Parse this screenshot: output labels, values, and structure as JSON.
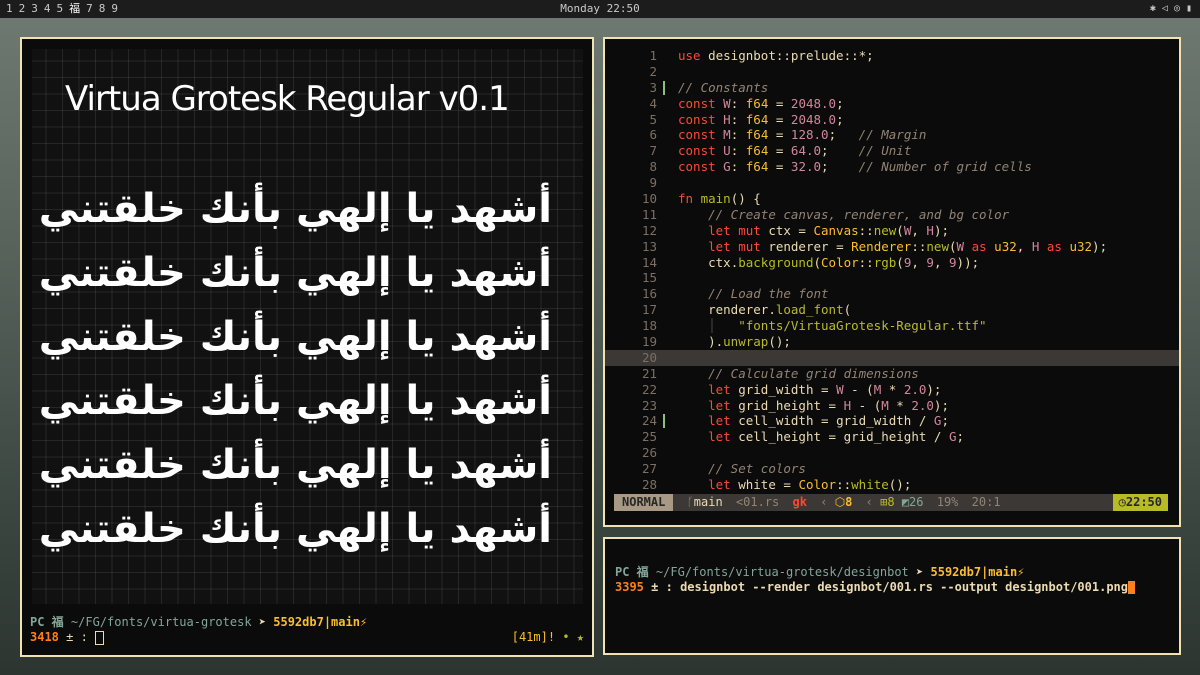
{
  "topbar": {
    "workspaces": [
      "1",
      "2",
      "3",
      "4",
      "5",
      "福",
      "7",
      "8",
      "9"
    ],
    "clock": "Monday 22:50",
    "tray_icons": [
      "bluetooth-icon",
      "speaker-icon",
      "wifi-icon",
      "battery-icon"
    ]
  },
  "preview": {
    "title": "Virtua Grotesk Regular v0.1",
    "arabic_lines": [
      "أشهد يا إلهي بأنك خلقتني",
      "أشهد يا إلهي بأنك خلقتني",
      "أشهد يا إلهي بأنك خلقتني",
      "أشهد يا إلهي بأنك خلقتني",
      "أشهد يا إلهي بأنك خلقتني",
      "أشهد يا إلهي بأنك خلقتني"
    ]
  },
  "left_shell": {
    "host": "PC 福",
    "path": "~/FG/fonts/virtua-grotesk",
    "arrow": "➤",
    "git": "5592db7|main⚡",
    "line_no": "3418",
    "prompt_sym": "± :",
    "timer": "[41m]!",
    "dots": "• ★"
  },
  "editor": {
    "lines": [
      {
        "n": "1",
        "code": "use designbot::prelude::*;"
      },
      {
        "n": "2",
        "code": ""
      },
      {
        "n": "3",
        "code": "// Constants",
        "mark": true
      },
      {
        "n": "4",
        "code": "const W: f64 = 2048.0;"
      },
      {
        "n": "5",
        "code": "const H: f64 = 2048.0;"
      },
      {
        "n": "6",
        "code": "const M: f64 = 128.0;   // Margin"
      },
      {
        "n": "7",
        "code": "const U: f64 = 64.0;    // Unit"
      },
      {
        "n": "8",
        "code": "const G: f64 = 32.0;    // Number of grid cells"
      },
      {
        "n": "9",
        "code": ""
      },
      {
        "n": "10",
        "code": "fn main() {"
      },
      {
        "n": "11",
        "code": "    // Create canvas, renderer, and bg color"
      },
      {
        "n": "12",
        "code": "    let mut ctx = Canvas::new(W, H);"
      },
      {
        "n": "13",
        "code": "    let mut renderer = Renderer::new(W as u32, H as u32);"
      },
      {
        "n": "14",
        "code": "    ctx.background(Color::rgb(9, 9, 9));"
      },
      {
        "n": "15",
        "code": ""
      },
      {
        "n": "16",
        "code": "    // Load the font"
      },
      {
        "n": "17",
        "code": "    renderer.load_font("
      },
      {
        "n": "18",
        "code": "    │   \"fonts/VirtuaGrotesk-Regular.ttf\""
      },
      {
        "n": "19",
        "code": "    ).unwrap();"
      },
      {
        "n": "20",
        "code": "",
        "current": true
      },
      {
        "n": "21",
        "code": "    // Calculate grid dimensions"
      },
      {
        "n": "22",
        "code": "    let grid_width = W - (M * 2.0);"
      },
      {
        "n": "23",
        "code": "    let grid_height = H - (M * 2.0);"
      },
      {
        "n": "24",
        "code": "    let cell_width = grid_width / G;",
        "mark": true
      },
      {
        "n": "25",
        "code": "    let cell_height = grid_height / G;"
      },
      {
        "n": "26",
        "code": ""
      },
      {
        "n": "27",
        "code": "    // Set colors"
      },
      {
        "n": "28",
        "code": "    let white = Color::white();"
      }
    ],
    "status": {
      "mode": "NORMAL",
      "branch": "main",
      "file": "<01.rs",
      "flag": "gk",
      "pkg_count": "8",
      "added": "8",
      "modified": "26",
      "percent": "19%",
      "position": "20:1",
      "time": "22:50"
    }
  },
  "terminal": {
    "host": "PC 福",
    "path": "~/FG/fonts/virtua-grotesk/designbot",
    "arrow": "➤",
    "git": "5592db7|main⚡",
    "line_no": "3395",
    "prompt_sym": "± :",
    "command": "designbot --render designbot/001.rs --output designbot/001.png"
  }
}
